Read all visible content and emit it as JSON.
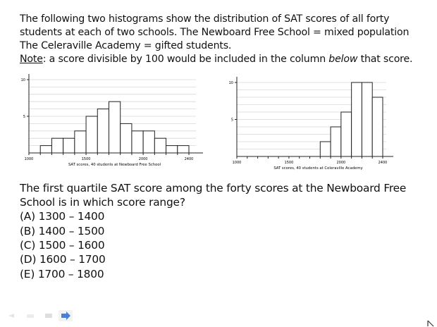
{
  "intro": {
    "line1": "The following two histograms show the distribution of SAT scores of all forty",
    "line2": "students at each of two schools.  The Newboard Free School = mixed population",
    "line3": "The Celeraville Academy = gifted students.",
    "note_label": "Note",
    "note_text_a": ": a score divisible by 100 would be included in the column ",
    "note_emph": "below",
    "note_text_b": " that score."
  },
  "chart_data": [
    {
      "type": "bar",
      "xlabel": "SAT scores, 40 students at Newboard Free School",
      "bin_edges": [
        1100,
        1200,
        1300,
        1400,
        1500,
        1600,
        1700,
        1800,
        1900,
        2000,
        2100,
        2200,
        2300,
        2400
      ],
      "values": [
        1,
        2,
        2,
        3,
        5,
        6,
        7,
        4,
        3,
        3,
        2,
        1,
        1
      ],
      "xlim": [
        1000,
        2400
      ],
      "ylim": [
        0,
        10
      ],
      "x_ticks": [
        "1000",
        "1500",
        "2000",
        "2400"
      ],
      "y_ticks": [
        "5",
        "10"
      ],
      "grid": true
    },
    {
      "type": "bar",
      "xlabel": "SAT scores, 40 students at Celeraville Academy",
      "bin_edges": [
        1800,
        1900,
        2000,
        2100,
        2200,
        2300,
        2400
      ],
      "values": [
        2,
        4,
        6,
        10,
        10,
        8
      ],
      "xlim": [
        1000,
        2400
      ],
      "ylim": [
        0,
        10
      ],
      "x_ticks": [
        "1000",
        "1500",
        "2000",
        "2400"
      ],
      "y_ticks": [
        "5",
        "10"
      ],
      "grid": true
    }
  ],
  "question": {
    "line1": "The first quartile SAT score among the forty scores at the Newboard Free",
    "line2": "School is in which score range?",
    "options": [
      "(A) 1300 – 1400",
      "(B) 1400 – 1500",
      "(C) 1500 – 1600",
      "(D) 1600 – 1700",
      "(E) 1700 – 1800"
    ]
  },
  "nav": {
    "icons": [
      "back-arrow-icon",
      "home-icon",
      "menu-icon",
      "forward-arrow-icon"
    ],
    "accent": "#4a7fd6"
  }
}
